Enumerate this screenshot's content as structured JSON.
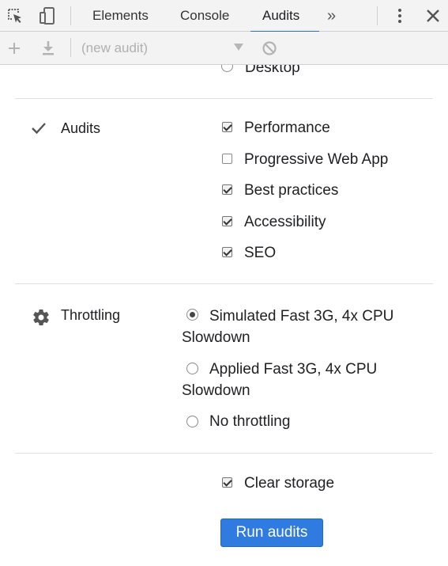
{
  "tabs": {
    "elements": "Elements",
    "console": "Console",
    "audits": "Audits",
    "more": "»"
  },
  "toolbar": {
    "audit_select": "(new audit)"
  },
  "device": {
    "desktop_label": "Desktop"
  },
  "audits": {
    "label": "Audits",
    "items": [
      {
        "label": "Performance",
        "checked": true
      },
      {
        "label": "Progressive Web App",
        "checked": false
      },
      {
        "label": "Best practices",
        "checked": true
      },
      {
        "label": "Accessibility",
        "checked": true
      },
      {
        "label": "SEO",
        "checked": true
      }
    ]
  },
  "throttling": {
    "label": "Throttling",
    "options": [
      {
        "label": "Simulated Fast 3G, 4x CPU Slowdown",
        "checked": true
      },
      {
        "label": "Applied Fast 3G, 4x CPU Slowdown",
        "checked": false
      },
      {
        "label": "No throttling",
        "checked": false
      }
    ]
  },
  "clear_storage": {
    "label": "Clear storage",
    "checked": true
  },
  "run_button": "Run audits",
  "colors": {
    "accent": "#1a73e8",
    "button": "#2f7be0"
  }
}
